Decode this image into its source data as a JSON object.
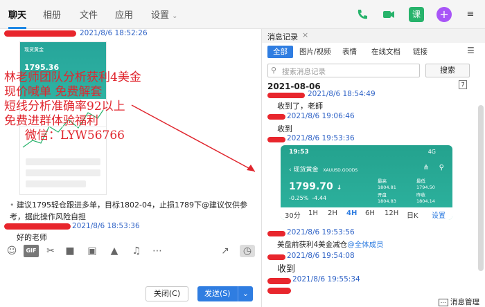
{
  "nav": {
    "tabs": [
      "聊天",
      "相册",
      "文件",
      "应用",
      "设置"
    ],
    "right_icons": [
      "phone-icon",
      "video-icon",
      "class-icon",
      "add-icon",
      "more-icon"
    ],
    "course_label": "课"
  },
  "chat": {
    "messages": [
      {
        "ts": "2021/8/6 18:52:26"
      },
      {
        "text": "建议1795轻仓跟进多单，目标1802-04，止损1789下@建议仅供参考，据此操作风险自担"
      },
      {
        "ts": "2021/8/6 18:53:36"
      },
      {
        "text": "好的老师"
      }
    ],
    "overlay_lines": [
      "林老师团队分析获利4美金",
      "现价喊单    免费解套",
      "短线分析准确率92以上",
      "免费进群体验福利",
      "微信：LYW56766"
    ],
    "phone": {
      "title": "现货黄金",
      "price": "1795.36"
    }
  },
  "composer": {
    "tools": [
      "emoji-icon",
      "gif-icon",
      "scissors-icon",
      "folder-icon",
      "file-icon",
      "image-icon",
      "bell-icon",
      "more-icon"
    ],
    "gif_label": "GIF",
    "close_label": "关闭(C)",
    "send_label": "发送(S)"
  },
  "history": {
    "title": "消息记录",
    "filters": [
      "全部",
      "图片/视频",
      "表情",
      "在线文档",
      "链接"
    ],
    "search_placeholder": "搜索消息记录",
    "search_button": "搜索",
    "date": "2021-08-06",
    "items": [
      {
        "ts": "2021/8/6 18:54:49",
        "text": "收到了，老師"
      },
      {
        "ts": "2021/8/6 19:06:46",
        "text": "收到"
      },
      {
        "ts": "2021/8/6 19:53:36",
        "text": ""
      },
      {
        "ts": "2021/8/6 19:53:56",
        "text": "美盘前获利4美金减仓",
        "mention": "@全体成员"
      },
      {
        "ts": "2021/8/6 19:54:08",
        "text": "收到"
      },
      {
        "ts": "2021/8/6 19:55:34",
        "text": ""
      }
    ],
    "shot": {
      "time": "19:53",
      "signal": "4G",
      "title": "现货黄金",
      "code": "XAUUSD.GOODS",
      "price": "1799.70",
      "change_pct": "-0.25%",
      "change": "-4.44",
      "high_label": "最高",
      "high": "1804.81",
      "low_label": "最低",
      "low": "1794.50",
      "open_label": "开盘",
      "open": "1804.83",
      "prev_label": "昨收",
      "prev": "1804.14",
      "timeframes": [
        "30分",
        "1H",
        "2H",
        "4H",
        "6H",
        "12H",
        "日K"
      ],
      "settings": "设置",
      "active_tf": "4H"
    },
    "manage": "消息管理"
  }
}
